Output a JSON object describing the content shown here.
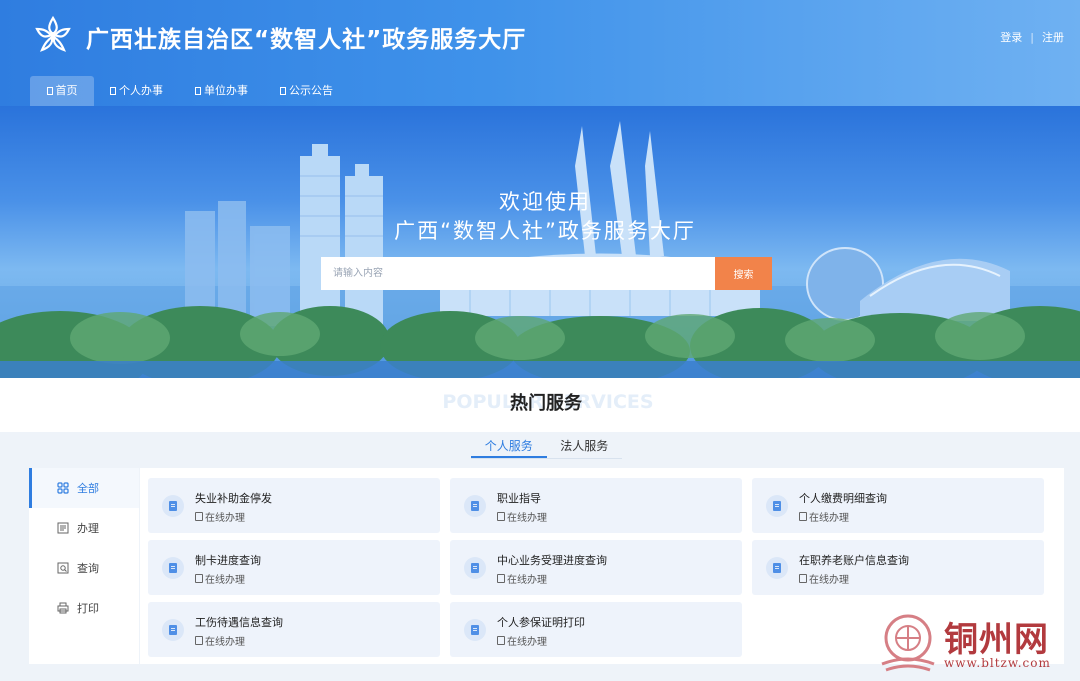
{
  "header": {
    "title": "广西壮族自治区“数智人社”政务服务大厅",
    "login": "登录",
    "register": "注册"
  },
  "nav": [
    {
      "label": "首页",
      "active": true
    },
    {
      "label": "个人办事",
      "active": false
    },
    {
      "label": "单位办事",
      "active": false
    },
    {
      "label": "公示公告",
      "active": false
    }
  ],
  "banner": {
    "welcome_line1": "欢迎使用",
    "welcome_line2": "广西“数智人社”政务服务大厅",
    "search_placeholder": "请输入内容",
    "search_button": "搜索"
  },
  "hot": {
    "bg_text": "POPULAR SERVICES",
    "title": "热门服务",
    "tabs": [
      {
        "label": "个人服务",
        "active": true
      },
      {
        "label": "法人服务",
        "active": false
      }
    ]
  },
  "side_menu": [
    {
      "label": "全部",
      "icon": "grid-icon",
      "active": true
    },
    {
      "label": "办理",
      "icon": "form-icon",
      "active": false
    },
    {
      "label": "查询",
      "icon": "query-icon",
      "active": false
    },
    {
      "label": "打印",
      "icon": "printer-icon",
      "active": false
    }
  ],
  "services": [
    {
      "name": "失业补助金停发",
      "sub": "在线办理"
    },
    {
      "name": "职业指导",
      "sub": "在线办理"
    },
    {
      "name": "个人缴费明细查询",
      "sub": "在线办理"
    },
    {
      "name": "制卡进度查询",
      "sub": "在线办理"
    },
    {
      "name": "中心业务受理进度查询",
      "sub": "在线办理"
    },
    {
      "name": "在职养老账户信息查询",
      "sub": "在线办理"
    },
    {
      "name": "工伤待遇信息查询",
      "sub": "在线办理"
    },
    {
      "name": "个人参保证明打印",
      "sub": "在线办理"
    }
  ],
  "watermark": {
    "text": "铜州网",
    "url": "www.bltzw.com"
  },
  "colors": {
    "primary": "#2f7de0",
    "search_button": "#f2834a",
    "watermark": "#b23a3e"
  }
}
